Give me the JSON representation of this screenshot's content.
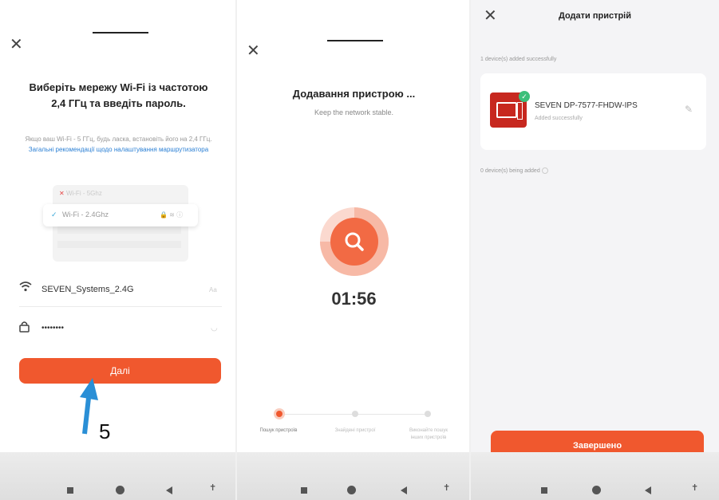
{
  "panel1": {
    "close": "✕",
    "title": "Виберіть мережу Wi-Fi із частотою 2,4 ГГц та введіть пароль.",
    "hint": "Якщо ваш Wi-Fi - 5 ГГц, будь ласка, встановіть його на 2,4 ГГц.",
    "hint_link": "Загальні рекомендації щодо налаштування маршрутизатора",
    "wifi_5g_label": "Wi-Fi - 5Ghz",
    "wifi_24_label": "Wi-Fi - 2.4Ghz",
    "ssid": "SEVEN_Systems_2.4G",
    "ssid_suffix": "Aa",
    "password": "••••••••",
    "next_button": "Далі",
    "annotation_number": "5"
  },
  "panel2": {
    "close": "✕",
    "title": "Додавання пристрою ...",
    "subtitle": "Keep the network stable.",
    "timer": "01:56",
    "steps": [
      {
        "label": "Пошук пристроїв"
      },
      {
        "label": "Знайдені пристрої"
      },
      {
        "label": "Виконайте пошук інших пристроїв"
      }
    ]
  },
  "panel3": {
    "close": "✕",
    "title": "Додати пристрій",
    "added_count": "1 device(s) added successfully",
    "device_name": "SEVEN DP-7577-FHDW-IPS",
    "device_status": "Added successfully",
    "being_added": "0 device(s) being added",
    "done_button": "Завершено"
  },
  "colors": {
    "accent": "#f0582e",
    "annotation_arrow": "#2a8fd6",
    "success": "#3cbf7a"
  }
}
